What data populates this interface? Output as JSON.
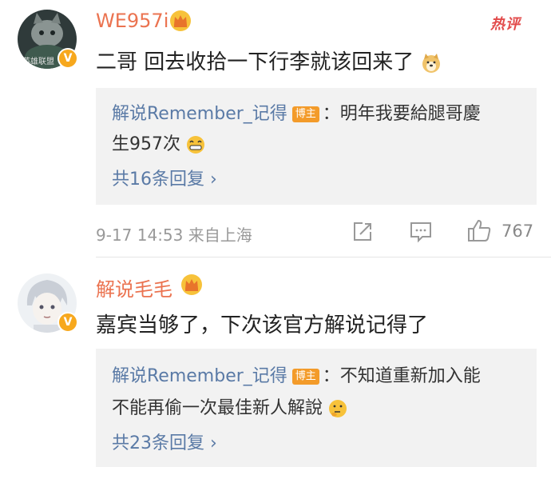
{
  "hot_label": "热评",
  "comments": [
    {
      "username": "WE957i",
      "avatar_caption": "英雄联盟",
      "text": "二哥 回去收拾一下行李就该回来了",
      "emoji": "doge-emoji",
      "reply": {
        "author": "解说Remember_记得",
        "tag": "博主",
        "line1": "：明年我要給腿哥慶",
        "line2": "生957次",
        "line2_emoji": "grin-emoji",
        "more": "共16条回复 ›"
      },
      "meta": "9-17 14:53 来自上海",
      "likes": "767"
    },
    {
      "username": "解说毛毛",
      "text": "嘉宾当够了，下次该官方解说记得了",
      "reply": {
        "author": "解说Remember_记得",
        "tag": "博主",
        "line1": "：不知道重新加入能",
        "line2": "不能再偷一次最佳新人解說",
        "line2_emoji": "thinking-emoji",
        "more": "共23条回复 ›"
      }
    }
  ],
  "colors": {
    "username": "#eb7350",
    "link": "#5a7aa6",
    "reply_bg": "#f2f2f2",
    "hot": "#e24b4b"
  }
}
